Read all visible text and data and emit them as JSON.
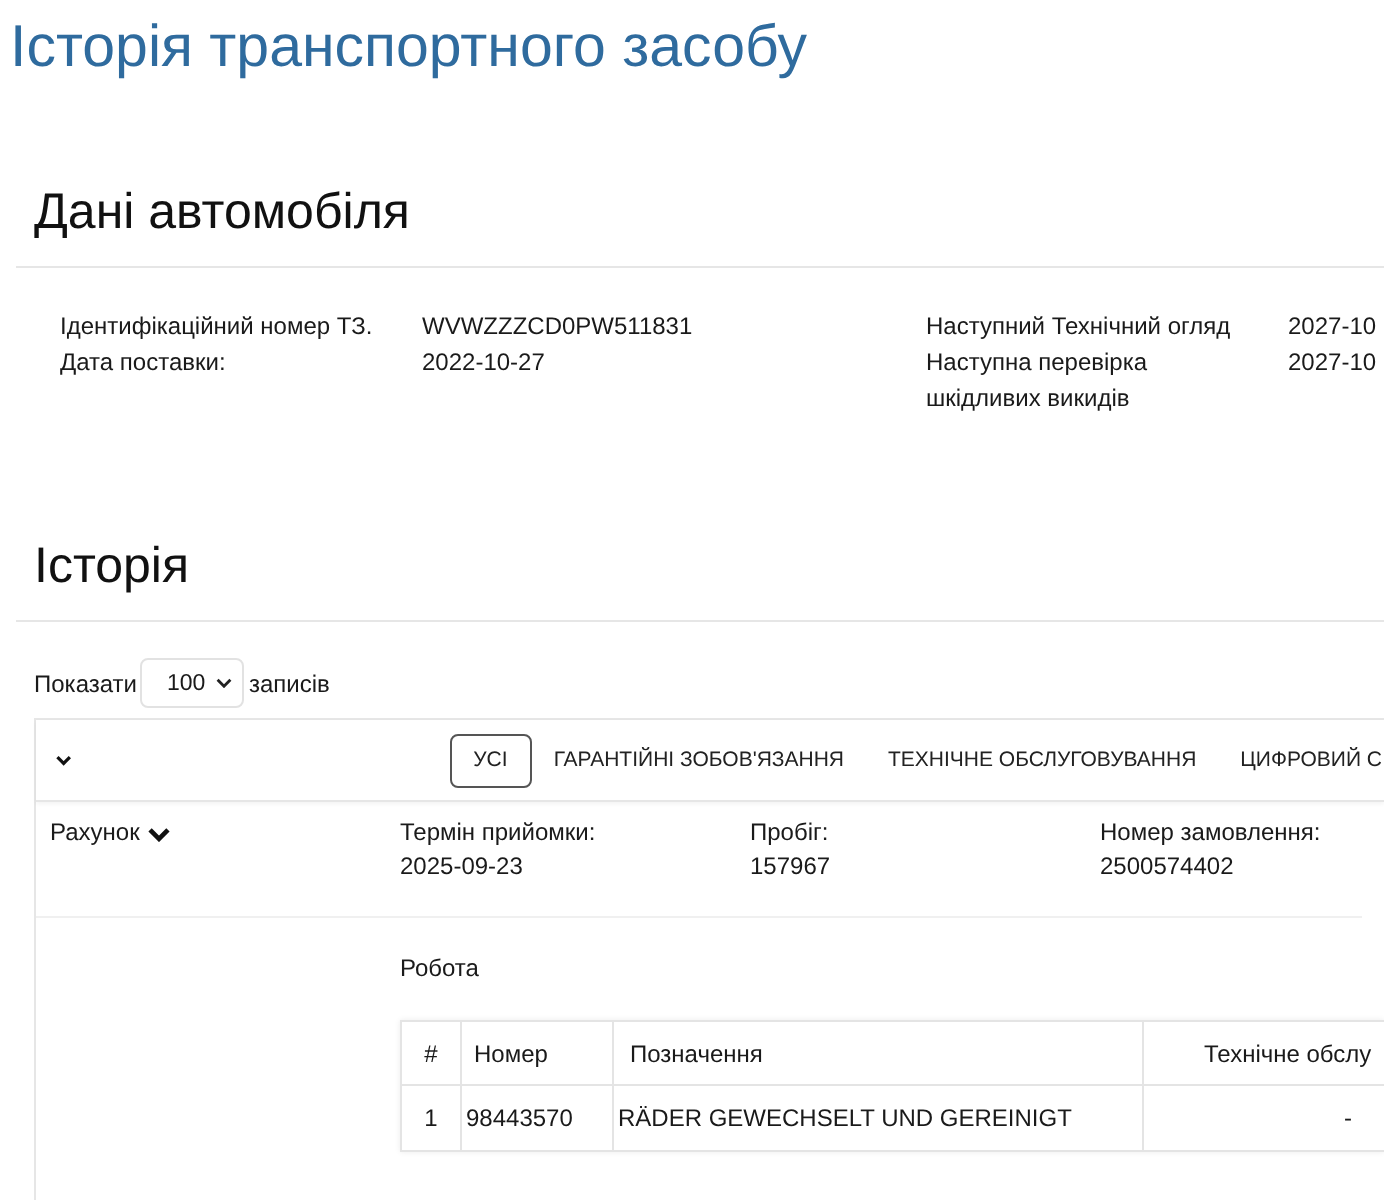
{
  "page_title": "Історія транспортного засобу",
  "vehicle_section": {
    "heading": "Дані автомобіля",
    "fields": [
      {
        "label": "Ідентифікаційний номер ТЗ.",
        "value": "WVWZZZCD0PW511831"
      },
      {
        "label": "Дата поставки:",
        "value": "2022-10-27"
      }
    ],
    "inspections": [
      {
        "label": "Наступний Технічний огляд",
        "value": "2027-10"
      },
      {
        "label": "Наступна перевірка шкідливих викидів",
        "value": "2027-10"
      }
    ]
  },
  "history_section": {
    "heading": "Історія",
    "page_length": {
      "label_before": "Показати",
      "value": "100",
      "label_after": "записів"
    },
    "tabs": [
      {
        "label": "УСІ",
        "selected": true
      },
      {
        "label": "ГАРАНТІЙНІ ЗОБОВ'ЯЗАННЯ",
        "selected": false
      },
      {
        "label": "ТЕХНІЧНЕ ОБСЛУГОВУВАННЯ",
        "selected": false
      },
      {
        "label": "ЦИФРОВИЙ С",
        "selected": false
      }
    ],
    "record": {
      "toggle_label": "Рахунок",
      "fields": [
        {
          "label": "Термін прийомки:",
          "value": "2025-09-23"
        },
        {
          "label": "Пробіг:",
          "value": "157967"
        },
        {
          "label": "Номер замовлення:",
          "value": "2500574402"
        }
      ],
      "work": {
        "heading": "Робота",
        "columns": [
          "#",
          "Номер",
          "Позначення",
          "Технічне обслу"
        ],
        "rows": [
          [
            "1",
            "98443570",
            "RÄDER GEWECHSELT UND GEREINIGT",
            "-"
          ]
        ]
      }
    }
  }
}
